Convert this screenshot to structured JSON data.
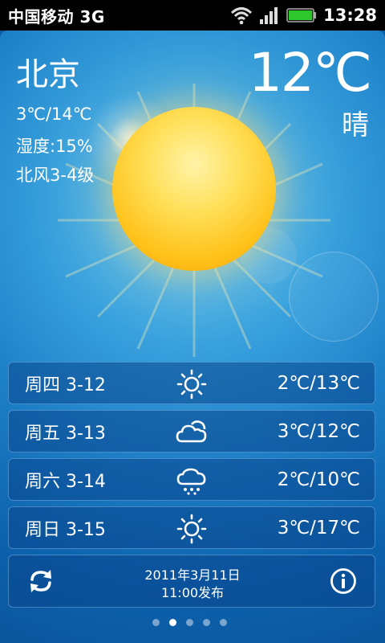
{
  "status_bar": {
    "carrier": "中国移动 3G",
    "time": "13:28",
    "icons": [
      "wifi-icon",
      "signal-icon",
      "battery-icon"
    ]
  },
  "weather": {
    "city": "北京",
    "current_temp": "12℃",
    "condition": "晴",
    "range": "3℃/14℃",
    "humidity": "湿度:15%",
    "wind": "北风3-4级"
  },
  "forecast": [
    {
      "date": "周四 3-12",
      "icon": "sunny-icon",
      "temp": "2℃/13℃"
    },
    {
      "date": "周五 3-13",
      "icon": "cloudy-icon",
      "temp": "3℃/12℃"
    },
    {
      "date": "周六 3-14",
      "icon": "rain-icon",
      "temp": "2℃/10℃"
    },
    {
      "date": "周日 3-15",
      "icon": "sunny-icon",
      "temp": "3℃/17℃"
    }
  ],
  "footer": {
    "published_date": "2011年3月11日",
    "published_time": "11:00发布",
    "refresh_icon": "refresh-icon",
    "info_icon": "info-icon"
  },
  "pager": {
    "count": 5,
    "active_index": 1
  },
  "colors": {
    "accent_blue": "#1c7ec6",
    "sun": "#ffc21a"
  }
}
